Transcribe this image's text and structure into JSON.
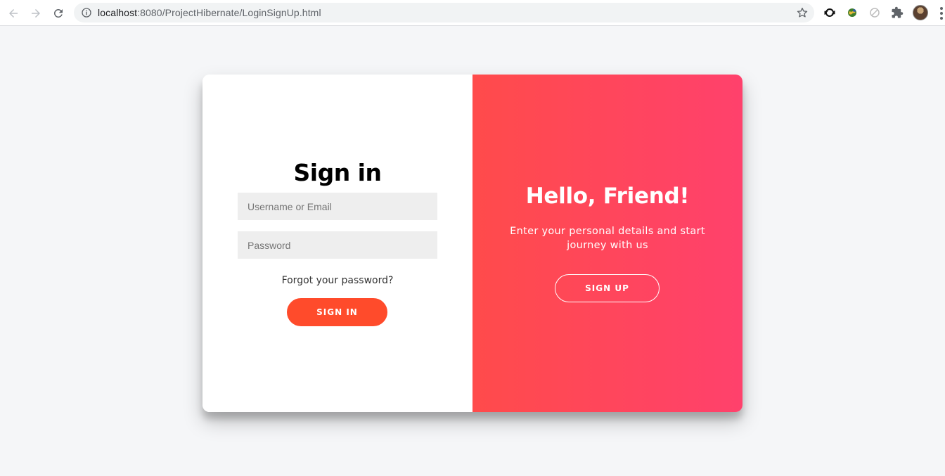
{
  "browser": {
    "url_host": "localhost",
    "url_path": ":8080/ProjectHibernate/LoginSignUp.html",
    "icons": [
      "back-arrow-icon",
      "forward-arrow-icon",
      "reload-icon",
      "info-icon",
      "star-icon",
      "extension-sync-icon",
      "extension-globe-icon",
      "extension-blocked-icon",
      "puzzle-icon",
      "profile-avatar",
      "kebab-menu-icon"
    ]
  },
  "signin": {
    "title": "Sign in",
    "username_placeholder": "Username or Email",
    "password_placeholder": "Password",
    "forgot_label": "Forgot your password?",
    "button_label": "SIGN IN"
  },
  "overlay": {
    "title": "Hello, Friend!",
    "text": "Enter your personal details and start journey with us",
    "button_label": "SIGN UP"
  },
  "colors": {
    "accent": "#ff4b2b",
    "gradient_start": "#ff4b4b",
    "gradient_end": "#ff416c",
    "page_bg": "#f5f6f8"
  }
}
